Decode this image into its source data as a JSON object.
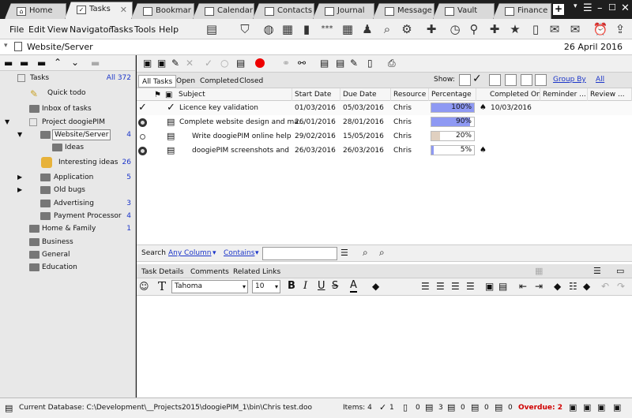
{
  "tabs": [
    {
      "label": "Home",
      "icon": "home-icon"
    },
    {
      "label": "Tasks",
      "icon": "tasks-icon"
    },
    {
      "label": "Bookmar",
      "icon": "bookmark-icon"
    },
    {
      "label": "Calendar",
      "icon": "calendar-icon"
    },
    {
      "label": "Contacts",
      "icon": "contacts-icon"
    },
    {
      "label": "Journal",
      "icon": "journal-icon"
    },
    {
      "label": "Message",
      "icon": "message-icon"
    },
    {
      "label": "Vault",
      "icon": "vault-icon"
    },
    {
      "label": "Finance",
      "icon": "finance-icon"
    }
  ],
  "menu": [
    "File",
    "Edit",
    "View",
    "Navigator",
    "Tasks",
    "Tools",
    "Help"
  ],
  "path": {
    "label": "Website/Server",
    "date": "26 April 2016"
  },
  "tree": {
    "root": {
      "label": "Tasks",
      "count": "All 372"
    },
    "items": [
      {
        "label": "Quick todo",
        "count": ""
      },
      {
        "label": "Inbox of tasks",
        "count": ""
      },
      {
        "label": "Project doogiePIM",
        "count": ""
      },
      {
        "label": "Website/Server",
        "count": "4"
      },
      {
        "label": "Ideas",
        "count": ""
      },
      {
        "label": "Interesting ideas",
        "count": "26"
      },
      {
        "label": "Application",
        "count": "5"
      },
      {
        "label": "Old bugs",
        "count": ""
      },
      {
        "label": "Advertising",
        "count": "3"
      },
      {
        "label": "Payment Processor",
        "count": "4"
      },
      {
        "label": "Home & Family",
        "count": "1"
      },
      {
        "label": "Business",
        "count": ""
      },
      {
        "label": "General",
        "count": ""
      },
      {
        "label": "Education",
        "count": ""
      }
    ]
  },
  "filters": {
    "tabs": [
      "All Tasks",
      "Open",
      "Completed",
      "Closed"
    ],
    "show_label": "Show:",
    "group_by": "Group By",
    "all": "All"
  },
  "columns": [
    "Subject",
    "Start Date",
    "Due Date",
    "Resource",
    "Percentage",
    "Completed On",
    "Reminder ...",
    "Review ..."
  ],
  "rows": [
    {
      "subject": "Licence key validation",
      "start": "01/03/2016",
      "due": "05/03/2016",
      "resource": "Chris",
      "pct": 1.0,
      "pct_label": "100%",
      "completed": "10/03/2016"
    },
    {
      "subject": "Complete website design and ma...",
      "start": "26/01/2016",
      "due": "28/01/2016",
      "resource": "Chris",
      "pct": 0.9,
      "pct_label": "90%",
      "completed": ""
    },
    {
      "subject": "Write doogiePIM online help",
      "start": "29/02/2016",
      "due": "15/05/2016",
      "resource": "Chris",
      "pct": 0.2,
      "pct_label": "20%",
      "completed": ""
    },
    {
      "subject": "doogiePIM screenshots and ...",
      "start": "26/03/2016",
      "due": "26/03/2016",
      "resource": "Chris",
      "pct": 0.05,
      "pct_label": "5%",
      "completed": ""
    }
  ],
  "search": {
    "label": "Search",
    "column": "Any Column",
    "op": "Contains",
    "value": ""
  },
  "detail_tabs": [
    "Task Details",
    "Comments",
    "Related Links"
  ],
  "editor": {
    "font": "Tahoma",
    "size": "10"
  },
  "status": {
    "db": "Current Database: C:\\Development\\__Projects2015\\doogiePIM_1\\bin\\Chris test.doo",
    "items": "Items: 4",
    "c1": "1",
    "c2": "0",
    "c3": "3",
    "c4": "0",
    "c5": "0",
    "c6": "0",
    "c7": "0",
    "overdue": "Overdue: 2"
  },
  "colors": {
    "accent": "#1b35c9",
    "progress": "#8e99f3",
    "overdue": "#d00000"
  }
}
